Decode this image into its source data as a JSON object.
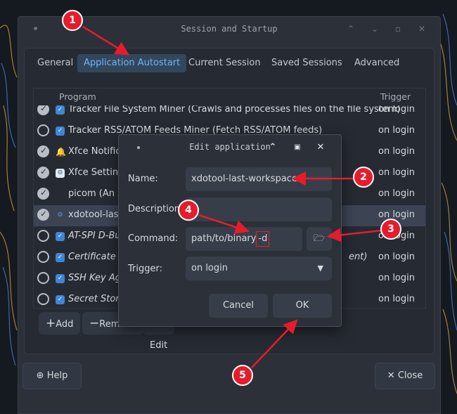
{
  "window": {
    "title": "Session and Startup"
  },
  "tabs": [
    {
      "label": "General"
    },
    {
      "label": "Application Autostart"
    },
    {
      "label": "Current Session"
    },
    {
      "label": "Saved Sessions"
    },
    {
      "label": "Advanced"
    }
  ],
  "list": {
    "col_program": "Program",
    "col_trigger": "Trigger",
    "rows": [
      {
        "name": "Tracker File System Miner (Crawls and processes files on the file system)",
        "trigger": "on login",
        "checked": true
      },
      {
        "name": "Tracker RSS/ATOM Feeds Miner (Fetch RSS/ATOM feeds)",
        "trigger": "on login",
        "checked": false
      },
      {
        "name": "Xfce Notificat",
        "trigger": "on login",
        "checked": true
      },
      {
        "name": "Xfce Setting",
        "trigger": "on login",
        "checked": true
      },
      {
        "name": "picom (An X",
        "trigger": "on login",
        "checked": true
      },
      {
        "name": "xdotool-last-w",
        "trigger": "on login",
        "checked": true
      },
      {
        "name": "AT-SPI D-Bu",
        "trigger": "on login",
        "checked": false
      },
      {
        "name": "Certificate a",
        "extra": "ent)",
        "trigger": "on login",
        "checked": false
      },
      {
        "name": "SSH Key Ag",
        "trigger": "on login",
        "checked": false
      },
      {
        "name": "Secret Stora",
        "trigger": "on login",
        "checked": false
      }
    ]
  },
  "actions": {
    "add": "Add",
    "remove": "Remove",
    "edit": "Edit"
  },
  "bottom": {
    "help": "Help",
    "close": "Close"
  },
  "dialog": {
    "title": "Edit application",
    "name_label": "Name:",
    "name_value": "xdotool-last-workspace",
    "description_label": "Description:",
    "description_value": "",
    "command_label": "Command:",
    "command_value": "path/to/binary",
    "command_flag": "-d",
    "trigger_label": "Trigger:",
    "trigger_value": "on login",
    "cancel": "Cancel",
    "ok": "OK"
  },
  "callouts": [
    "1",
    "2",
    "3",
    "4",
    "5"
  ],
  "colors": {
    "accent": "#6fb4f2",
    "callout": "#e61c2c"
  }
}
